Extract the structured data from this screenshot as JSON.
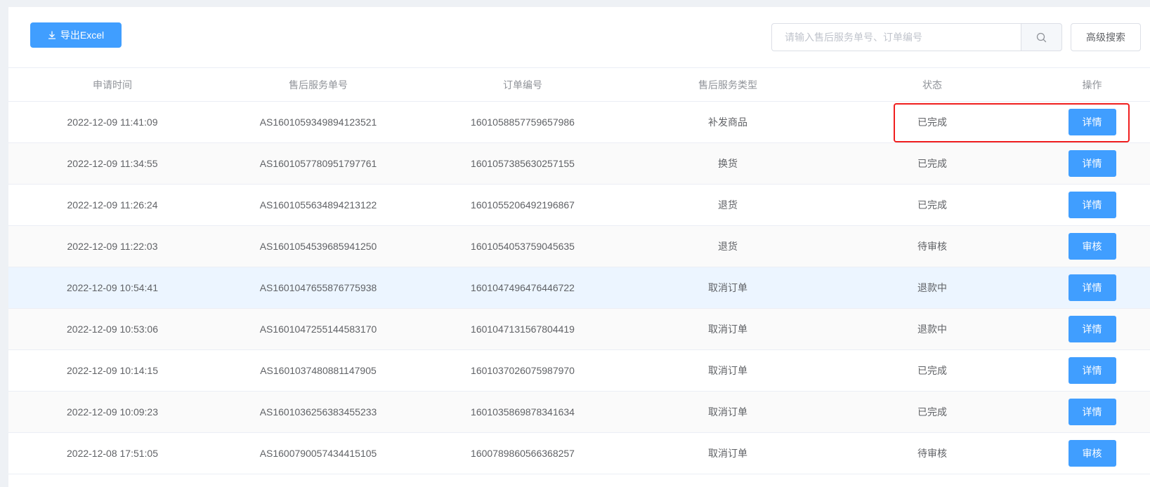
{
  "toolbar": {
    "export_label": "导出Excel",
    "search_placeholder": "请输入售后服务单号、订单编号",
    "search_value": "",
    "advanced_search_label": "高级搜索"
  },
  "table": {
    "headers": [
      "申请时间",
      "售后服务单号",
      "订单编号",
      "售后服务类型",
      "状态",
      "操作"
    ],
    "rows": [
      {
        "time": "2022-12-09 11:41:09",
        "service_no": "AS1601059349894123521",
        "order_no": "1601058857759657986",
        "type": "补发商品",
        "status": "已完成",
        "action": "详情"
      },
      {
        "time": "2022-12-09 11:34:55",
        "service_no": "AS1601057780951797761",
        "order_no": "1601057385630257155",
        "type": "换货",
        "status": "已完成",
        "action": "详情"
      },
      {
        "time": "2022-12-09 11:26:24",
        "service_no": "AS1601055634894213122",
        "order_no": "1601055206492196867",
        "type": "退货",
        "status": "已完成",
        "action": "详情"
      },
      {
        "time": "2022-12-09 11:22:03",
        "service_no": "AS1601054539685941250",
        "order_no": "1601054053759045635",
        "type": "退货",
        "status": "待审核",
        "action": "审核"
      },
      {
        "time": "2022-12-09 10:54:41",
        "service_no": "AS1601047655876775938",
        "order_no": "1601047496476446722",
        "type": "取消订单",
        "status": "退款中",
        "action": "详情"
      },
      {
        "time": "2022-12-09 10:53:06",
        "service_no": "AS1601047255144583170",
        "order_no": "1601047131567804419",
        "type": "取消订单",
        "status": "退款中",
        "action": "详情"
      },
      {
        "time": "2022-12-09 10:14:15",
        "service_no": "AS1601037480881147905",
        "order_no": "1601037026075987970",
        "type": "取消订单",
        "status": "已完成",
        "action": "详情"
      },
      {
        "time": "2022-12-09 10:09:23",
        "service_no": "AS1601036256383455233",
        "order_no": "1601035869878341634",
        "type": "取消订单",
        "status": "已完成",
        "action": "详情"
      },
      {
        "time": "2022-12-08 17:51:05",
        "service_no": "AS1600790057434415105",
        "order_no": "1600789860566368257",
        "type": "取消订单",
        "status": "待审核",
        "action": "审核"
      }
    ]
  },
  "colors": {
    "primary": "#409eff",
    "highlight": "#f01e1e",
    "hover_row": "#ecf5ff",
    "stripe_row": "#fafafa"
  },
  "icons": {
    "export": "download-icon",
    "search": "search-icon"
  }
}
